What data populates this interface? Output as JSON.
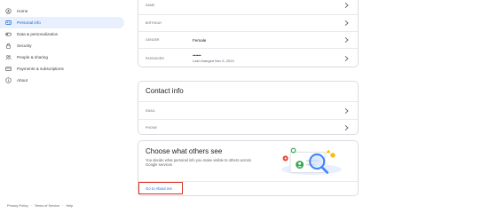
{
  "sidebar": {
    "items": [
      {
        "label": "Home",
        "icon": "home-icon"
      },
      {
        "label": "Personal info",
        "icon": "person-card-icon",
        "active": true
      },
      {
        "label": "Data & personalization",
        "icon": "toggle-icon"
      },
      {
        "label": "Security",
        "icon": "lock-icon"
      },
      {
        "label": "People & sharing",
        "icon": "people-icon"
      },
      {
        "label": "Payments & subscriptions",
        "icon": "credit-card-icon"
      },
      {
        "label": "About",
        "icon": "info-icon"
      }
    ]
  },
  "basic_info": {
    "rows": [
      {
        "label": "NAME",
        "value": ""
      },
      {
        "label": "BIRTHDAY",
        "value": ""
      },
      {
        "label": "GENDER",
        "value": "Female"
      },
      {
        "label": "PASSWORD",
        "value": "••••••",
        "sub": "Last changed Nov 5, 2024"
      }
    ]
  },
  "contact_info": {
    "title": "Contact info",
    "rows": [
      {
        "label": "EMAIL",
        "value": ""
      },
      {
        "label": "PHONE",
        "value": ""
      }
    ]
  },
  "choose_share": {
    "title": "Choose what others see",
    "description": "You decide what personal info you make visible to others across Google services",
    "link_label": "Go to About me"
  },
  "footer": {
    "links": [
      "Privacy Policy",
      "Terms of Service",
      "Help"
    ],
    "separator": "·"
  },
  "colors": {
    "accent": "#1a73e8",
    "active_bg": "#e8f0fe",
    "highlight_border": "#d93025"
  }
}
